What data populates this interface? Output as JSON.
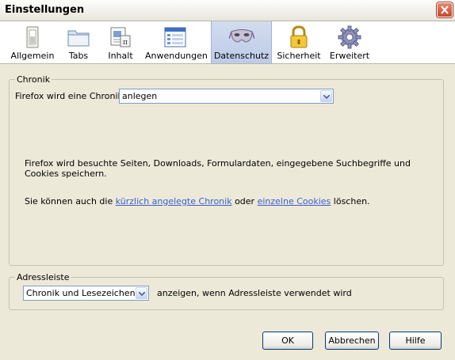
{
  "window": {
    "title": "Einstellungen",
    "close_label": "close"
  },
  "toolbar": {
    "tabs": [
      {
        "label": "Allgemein",
        "icon": "switch-icon",
        "selected": false
      },
      {
        "label": "Tabs",
        "icon": "folder-icon",
        "selected": false
      },
      {
        "label": "Inhalt",
        "icon": "document-icon",
        "selected": false
      },
      {
        "label": "Anwendungen",
        "icon": "application-window-icon",
        "selected": false
      },
      {
        "label": "Datenschutz",
        "icon": "mask-icon",
        "selected": true
      },
      {
        "label": "Sicherheit",
        "icon": "padlock-icon",
        "selected": false
      },
      {
        "label": "Erweitert",
        "icon": "gear-icon",
        "selected": false
      }
    ]
  },
  "chronik": {
    "legend": "Chronik",
    "label": "Firefox wird eine Chronik:",
    "select_value": "anlegen",
    "description": "Firefox wird besuchte Seiten, Downloads, Formulardaten, eingegebene Suchbegriffe und Cookies speichern.",
    "clear_prefix": "Sie können auch die ",
    "link_recent": "kürzlich angelegte Chronik",
    "clear_middle": " oder ",
    "link_cookies": "einzelne Cookies",
    "clear_suffix": " löschen."
  },
  "adressleiste": {
    "legend": "Adressleiste",
    "select_value": "Chronik und Lesezeichen",
    "suffix": "anzeigen, wenn Adressleiste verwendet wird"
  },
  "buttons": {
    "ok": "OK",
    "cancel": "Abbrechen",
    "help": "Hilfe"
  },
  "colors": {
    "link": "#3a5fcd",
    "selected_tab": "#c6d2ea",
    "dialog_bg": "#ece9d8"
  }
}
